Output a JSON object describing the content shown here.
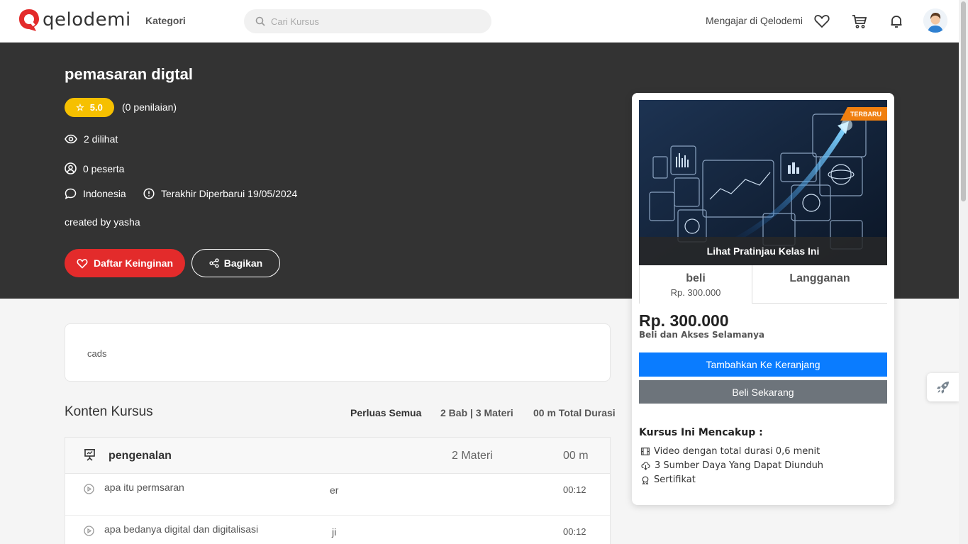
{
  "header": {
    "logo_text": "qelodemi",
    "kategori_label": "Kategori",
    "search_placeholder": "Cari Kursus",
    "teach_label": "Mengajar di Qelodemi",
    "icons": [
      "heart-icon",
      "cart-icon",
      "bell-icon",
      "avatar"
    ]
  },
  "hero": {
    "title": "pemasaran digtal",
    "rating": "5.0",
    "rating_count": "(0 penilaian)",
    "views": "2 dilihat",
    "participants": "0 peserta",
    "language": "Indonesia",
    "last_updated": "Terakhir Diperbarui 19/05/2024",
    "created_by": "created by yasha",
    "wishlist_label": "Daftar Keinginan",
    "share_label": "Bagikan"
  },
  "description": {
    "text": "cads"
  },
  "content": {
    "title": "Konten Kursus",
    "expand_all": "Perluas Semua",
    "summary": "2 Bab | 3 Materi",
    "total_duration": "00 m Total Durasi",
    "sections": [
      {
        "name": "pengenalan",
        "count": "2 Materi",
        "duration": "00 m",
        "lessons": [
          {
            "title": "apa itu permsaran",
            "mid": "er",
            "time": "00:12"
          },
          {
            "title": "apa bedanya digital dan digitalisasi",
            "mid": "ji",
            "time": "00:12"
          }
        ]
      }
    ]
  },
  "purchase": {
    "badge": "TERBARU",
    "preview_label": "Lihat Pratinjau Kelas Ini",
    "tab_buy_title": "beli",
    "tab_buy_price": "Rp. 300.000",
    "tab_subscription": "Langganan",
    "price": "Rp. 300.000",
    "price_note": "Beli dan Akses Selamanya",
    "add_to_cart": "Tambahkan Ke Keranjang",
    "buy_now": "Beli Sekarang",
    "includes_title": "Kursus Ini Mencakup :",
    "includes": [
      "Video dengan total durasi 0,6 menit",
      "3 Sumber Daya Yang Dapat Diunduh",
      "Sertifikat"
    ]
  },
  "colors": {
    "brand_red": "#e32b2b",
    "rating_yellow": "#f6c000",
    "primary_blue": "#0a7cff",
    "badge_orange": "#f07f0f",
    "hero_bg": "#333333"
  }
}
